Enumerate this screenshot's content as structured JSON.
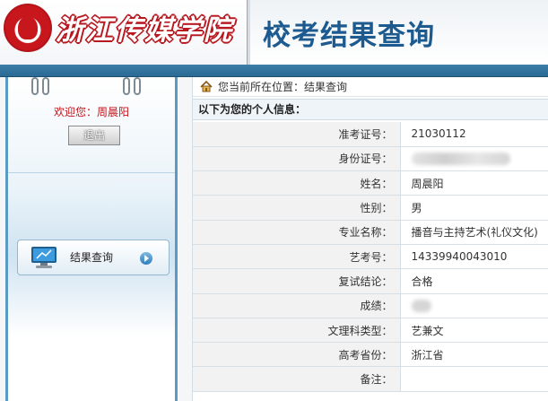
{
  "header": {
    "school_name": "浙江传媒学院",
    "system_title": "校考结果查询",
    "colors": {
      "brand_red": "#c8161d",
      "title_blue": "#1c5a8f",
      "bar_blue": "#2a6a94"
    }
  },
  "sidebar": {
    "welcome_prefix": "欢迎您：",
    "user_name": "周晨阳",
    "logout_label": "退出",
    "menu_items": [
      {
        "label": "结果查询",
        "icon": "monitor-icon"
      }
    ]
  },
  "main": {
    "breadcrumb": "您当前所在位置：结果查询",
    "section_title": "以下为您的个人信息：",
    "rows": [
      {
        "label": "准考证号：",
        "value": "21030112"
      },
      {
        "label": "身份证号：",
        "value": "",
        "redacted": true
      },
      {
        "label": "姓名：",
        "value": "周晨阳"
      },
      {
        "label": "性别：",
        "value": "男"
      },
      {
        "label": "专业名称：",
        "value": "播音与主持艺术(礼仪文化)"
      },
      {
        "label": "艺考号：",
        "value": "14339940043010"
      },
      {
        "label": "复试结论：",
        "value": "合格"
      },
      {
        "label": "成绩：",
        "value": "",
        "redacted": true
      },
      {
        "label": "文理科类型：",
        "value": "艺兼文"
      },
      {
        "label": "高考省份：",
        "value": "浙江省"
      },
      {
        "label": "备注：",
        "value": ""
      }
    ]
  }
}
